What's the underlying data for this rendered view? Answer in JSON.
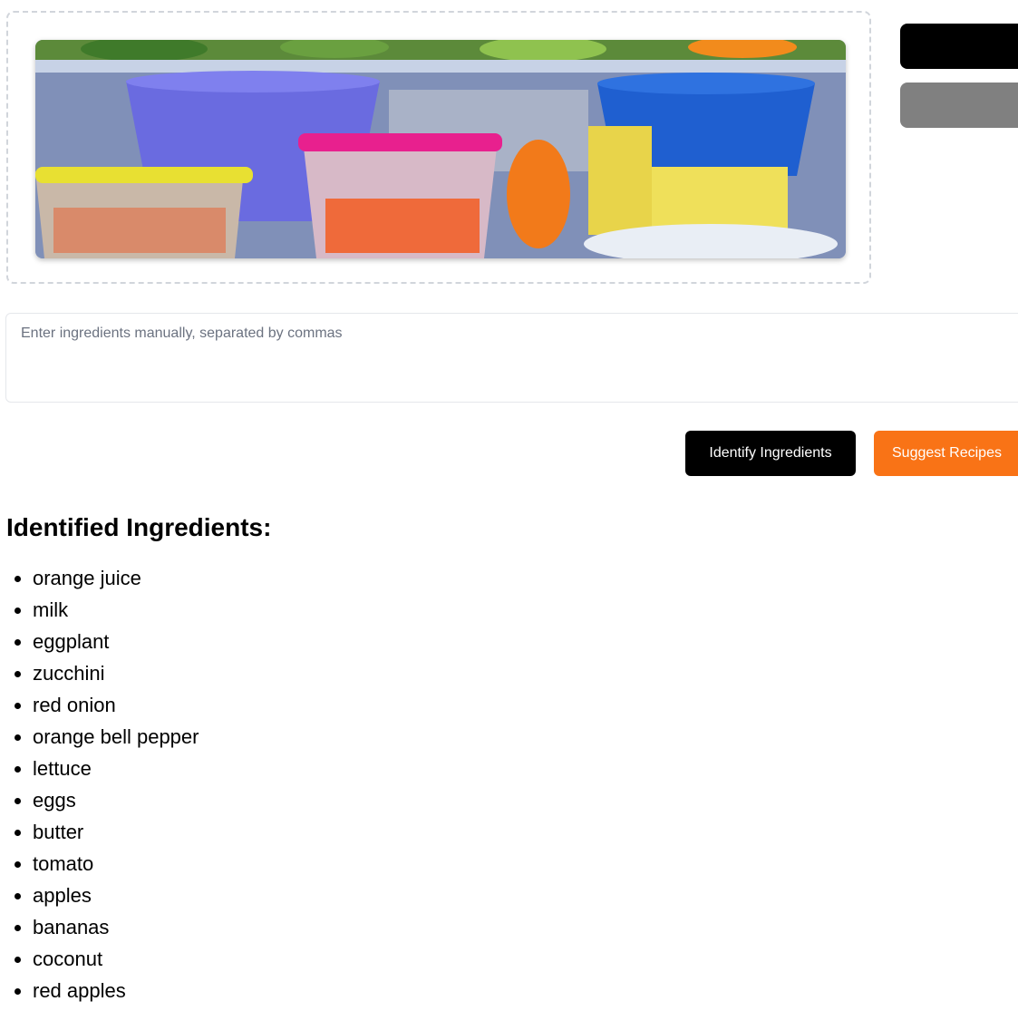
{
  "upload": {
    "image_alt": "Refrigerator shelf with food containers"
  },
  "side_actions": {
    "primary_label": "",
    "secondary_label": ""
  },
  "manual_input": {
    "placeholder": "Enter ingredients manually, separated by commas",
    "value": ""
  },
  "actions": {
    "identify_label": "Identify Ingredients",
    "suggest_label": "Suggest Recipes"
  },
  "results": {
    "title": "Identified Ingredients:",
    "ingredients": [
      "orange juice",
      "milk",
      "eggplant",
      "zucchini",
      "red onion",
      "orange bell pepper",
      "lettuce",
      "eggs",
      "butter",
      "tomato",
      "apples",
      "bananas",
      "coconut",
      "red apples"
    ]
  },
  "colors": {
    "accent_orange": "#f97316",
    "primary_black": "#000000",
    "secondary_gray": "#808080"
  }
}
